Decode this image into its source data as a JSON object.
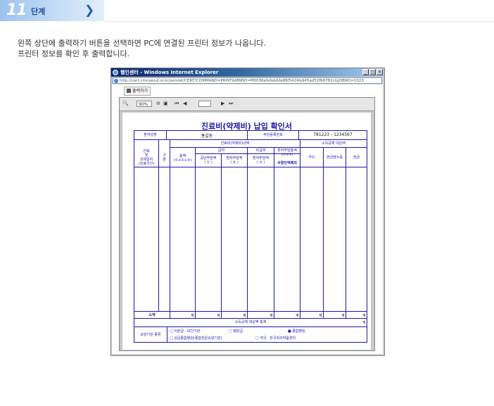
{
  "step": {
    "number": "11",
    "word": "단계"
  },
  "description": {
    "line1": "왼쪽 상단에 출력하기 버튼을 선택하면 PC에 연결된 프린터 정보가 나옵니다.",
    "line2": "프린터 정보를 확인 후 출력합니다."
  },
  "browser": {
    "title": "웹인센터 - Windows Internet Explorer",
    "url": "http://cert.cmcseoul.or.kr/servlet/CERT?COMMAND=PRINT&MNNO=M0036efefeb&fe86f5424&945ad52fb6782c&JOBNO=1023",
    "print_button": "출력하기"
  },
  "viewer": {
    "zoom": "90%"
  },
  "form": {
    "title": "진료비(약제비) 납입 확인서",
    "patient_name_label": "환자성명",
    "patient_name": "홍길동",
    "resident_no_label": "주민등록번호",
    "resident_no": "781223 - 1234567",
    "treatment_period_label": "진료\n및\n조제일자\n(진료기간)",
    "category_label": "구\n분",
    "detail_header": "진료비(약제비)내역",
    "total_label": "총액\n(①+②+③)",
    "covered_header": "급여",
    "uncovered_header": "비급여",
    "insurer_label": "공단부담액\n( ① )",
    "patient_copay_label": "환자부담액\n( ② )",
    "uncovered_patient_label": "환자부담액\n( ③ )",
    "patient_total_label": "환자부담총액\n(②+③)",
    "discount_label": "※할인액제외",
    "tax_header": "소득공제 대상액",
    "card_label": "카드",
    "cash_label": "현금영수증",
    "cash2_label": "현금",
    "subtotal_label": "소계",
    "unit": "계",
    "tax_total_label": "소득공제 대상액 총계",
    "institution_label": "요양기관 종류",
    "inst_options": [
      "□ 의원급 · 보건기관",
      "□ 병원급",
      "■ 종합병원",
      "□ 상급종합병원(종합전문요양기관)",
      "□ 약국 · 한국희귀약품센터"
    ]
  }
}
